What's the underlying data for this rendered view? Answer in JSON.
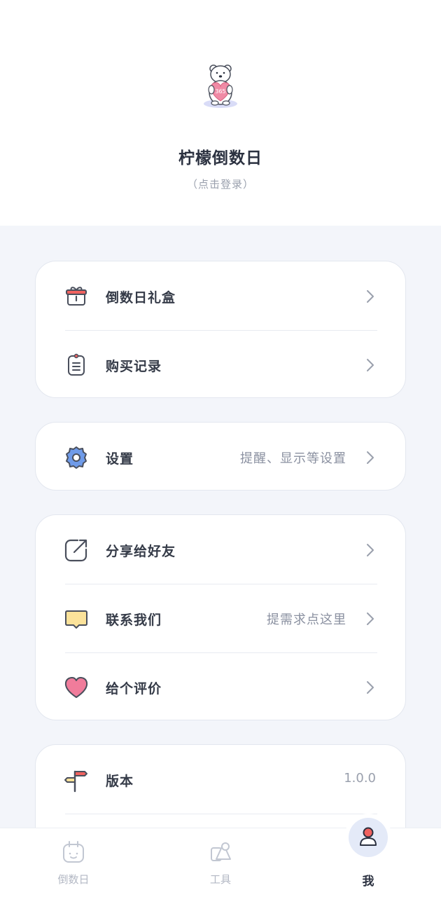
{
  "header": {
    "app_name": "柠檬倒数日",
    "login_hint": "（点击登录）",
    "avatar_badge_text": "365"
  },
  "menu_group_1": {
    "items": [
      {
        "label": "倒数日礼盒",
        "icon": "gift-icon"
      },
      {
        "label": "购买记录",
        "icon": "clipboard-icon"
      }
    ]
  },
  "menu_group_2": {
    "items": [
      {
        "label": "设置",
        "sub": "提醒、显示等设置",
        "icon": "gear-icon"
      }
    ]
  },
  "menu_group_3": {
    "items": [
      {
        "label": "分享给好友",
        "icon": "share-icon"
      },
      {
        "label": "联系我们",
        "sub": "提需求点这里",
        "icon": "chat-bubble-icon"
      },
      {
        "label": "给个评价",
        "icon": "heart-icon"
      }
    ]
  },
  "menu_group_4": {
    "items": [
      {
        "label": "版本",
        "value": "1.0.0",
        "icon": "signpost-icon"
      }
    ]
  },
  "tabbar": {
    "tabs": [
      {
        "label": "倒数日",
        "icon": "calendar-icon",
        "active": false
      },
      {
        "label": "工具",
        "icon": "tools-icon",
        "active": false
      },
      {
        "label": "我",
        "icon": "user-icon",
        "active": true
      }
    ]
  },
  "colors": {
    "page_bg": "#f3f5fa",
    "card_bg": "#ffffff",
    "text_primary": "#353b48",
    "text_secondary": "#8a90a0",
    "accent_blue": "#6f9be9",
    "accent_pink": "#f07c9b",
    "accent_yellow": "#fbe29a",
    "accent_red": "#f0625f"
  }
}
